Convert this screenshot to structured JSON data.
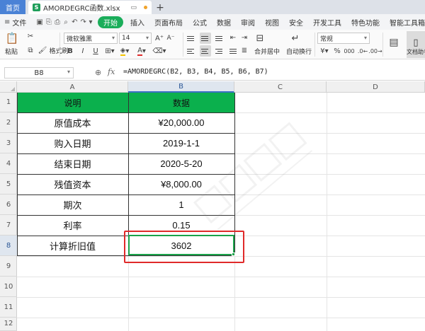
{
  "titlebar": {
    "home_tab": "首页",
    "file_tab": "AMORDEGRC函数.xlsx",
    "file_icon": "S",
    "new_tab": "+"
  },
  "menu": {
    "file": "文件",
    "start": "开始",
    "items": [
      "插入",
      "页面布局",
      "公式",
      "数据",
      "审阅",
      "视图",
      "安全",
      "开发工具",
      "特色功能",
      "智能工具箱"
    ]
  },
  "ribbon": {
    "paste": "粘贴",
    "format_painter": "格式刷",
    "font_name": "微软雅黑",
    "font_size": "14",
    "bold": "B",
    "italic": "I",
    "underline": "U",
    "merge_center": "合并居中",
    "wrap_text": "自动换行",
    "number_format": "常规",
    "percent": "%",
    "currency": "¥",
    "thousands": "000",
    "doc_assistant": "文档助手"
  },
  "formula_bar": {
    "cell_ref": "B8",
    "fx": "fx",
    "formula": "=AMORDEGRC(B2, B3, B4, B5, B6, B7)"
  },
  "columns": [
    "A",
    "B",
    "C",
    "D"
  ],
  "rows": [
    "1",
    "2",
    "3",
    "4",
    "5",
    "6",
    "7",
    "8",
    "9",
    "10",
    "11",
    "12"
  ],
  "table": {
    "header": [
      "说明",
      "数据"
    ],
    "rows": [
      [
        "原值成本",
        "¥20,000.00"
      ],
      [
        "购入日期",
        "2019-1-1"
      ],
      [
        "结束日期",
        "2020-5-20"
      ],
      [
        "残值资本",
        "¥8,000.00"
      ],
      [
        "期次",
        "1"
      ],
      [
        "利率",
        "0.15"
      ],
      [
        "计算折旧值",
        "3602"
      ]
    ]
  },
  "colors": {
    "header_green": "#0bb04d",
    "selection_green": "#1aa34a",
    "highlight_red": "#e02a2a",
    "home_tab_blue": "#4a82d6"
  }
}
